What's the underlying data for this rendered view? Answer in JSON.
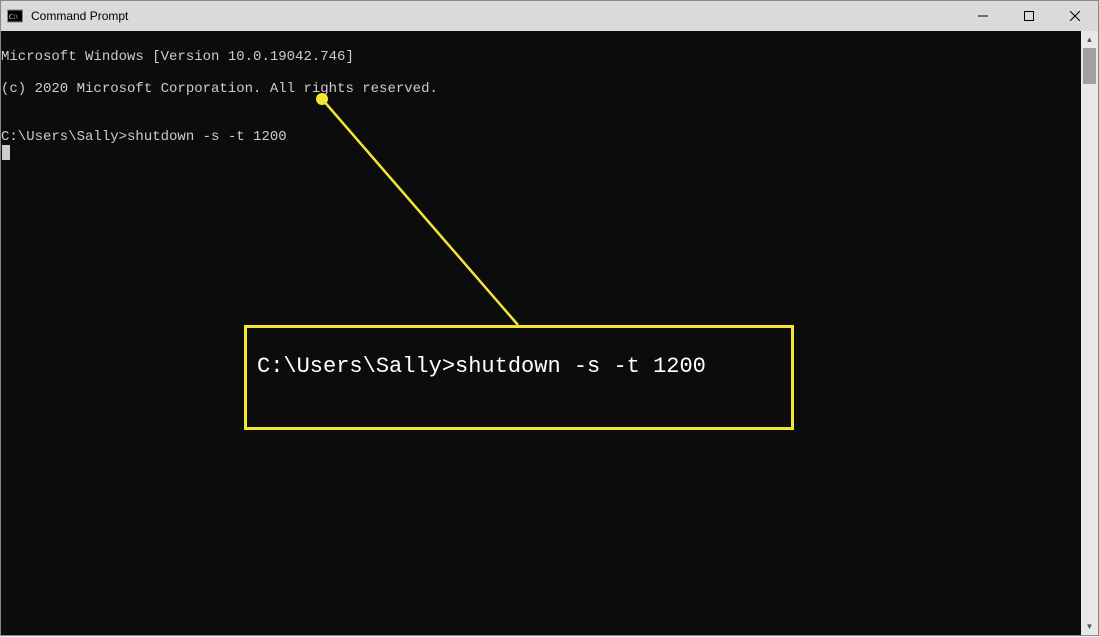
{
  "window": {
    "title": "Command Prompt"
  },
  "terminal": {
    "line1": "Microsoft Windows [Version 10.0.19042.746]",
    "line2": "(c) 2020 Microsoft Corporation. All rights reserved.",
    "blank": "",
    "prompt_line": "C:\\Users\\Sally>shutdown -s -t 1200"
  },
  "callout": {
    "text": "C:\\Users\\Sally>shutdown -s -t 1200",
    "accent_color": "#f2e635"
  }
}
